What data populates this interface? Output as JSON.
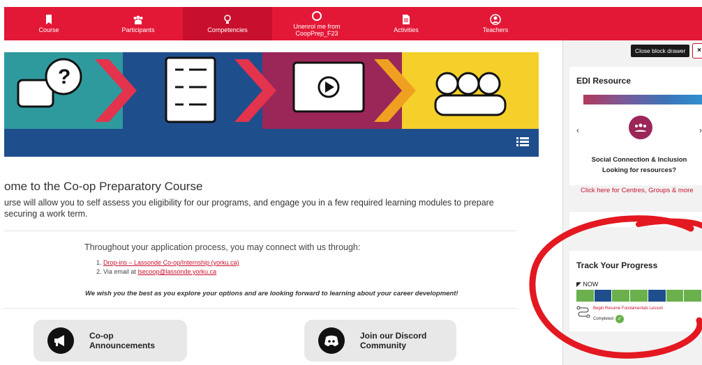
{
  "nav": {
    "items": [
      {
        "label": "Course",
        "icon": "bookmark-icon"
      },
      {
        "label": "Participants",
        "icon": "people-icon"
      },
      {
        "label": "Competencies",
        "icon": "lightbulb-icon",
        "active": true
      },
      {
        "label": "Unenrol me from CoopPrep_F23",
        "icon": "circle-icon"
      },
      {
        "label": "Activities",
        "icon": "file-icon"
      },
      {
        "label": "Teachers",
        "icon": "user-circle-icon"
      }
    ]
  },
  "main": {
    "welcome_title": "ome to the Co-op Preparatory Course",
    "description": "urse will allow you to self assess you eligibility for our programs, and engage you in a few required learning modules to prepare\n securing a work term.",
    "connect_intro": "Throughout your application process, you may connect with us through:",
    "contact_items": [
      {
        "prefix": "1. ",
        "link": "Drop-ins – Lassonde Co-op/Internship (yorku.ca)"
      },
      {
        "prefix": "2. Via email at ",
        "link": "lsecoop@lassonde.yorku.ca"
      }
    ],
    "closing": "We wish you the best as you explore your options and are looking forward to learning about your career development!",
    "cards": [
      {
        "label": "Co-op\nAnnouncements",
        "icon": "megaphone-icon"
      },
      {
        "label": "Join our Discord\nCommunity",
        "icon": "discord-icon"
      }
    ]
  },
  "drawer": {
    "close_label": "Close block drawer",
    "edi": {
      "title": "EDI Resource",
      "heading": "Social Connection & Inclusion\nLooking for resources?",
      "link": "Click here for Centres, Groups & more"
    },
    "progress": {
      "title": "Track Your Progress",
      "now_label": "NOW",
      "task_label": "Begin Resume Fundamentals Lesson",
      "status_label": "Completed",
      "segments": [
        "#6ab04c",
        "#1f4e8c",
        "#6ab04c",
        "#6ab04c",
        "#1f4e8c",
        "#6ab04c",
        "#6ab04c"
      ]
    }
  },
  "colors": {
    "brand_red": "#e31837",
    "active_red": "#c8102e",
    "banner_blue": "#1f4e8c",
    "progress_green": "#6ab04c"
  }
}
